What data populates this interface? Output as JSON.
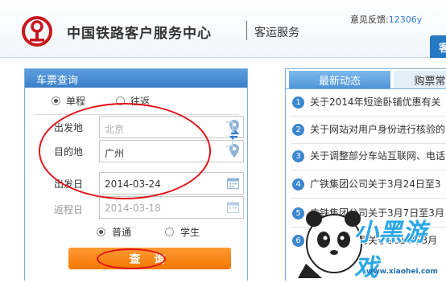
{
  "header": {
    "brand": "中国铁路客户服务中心",
    "subtitle": "客运服务",
    "feedback_label": "意见反馈:",
    "feedback_email": "12306y",
    "top_button": "客"
  },
  "ticket": {
    "title": "车票查询",
    "trip_oneway": "单程",
    "trip_return": "往返",
    "from_label": "出发地",
    "from_value": "北京",
    "to_label": "目的地",
    "to_value": "广州",
    "depart_label": "出发日",
    "depart_value": "2014-03-24",
    "return_label": "返程日",
    "return_value": "2014-03-18",
    "type_normal": "普通",
    "type_student": "学生",
    "search_label": "查 询"
  },
  "news": {
    "tab_active": "最新动态",
    "tab_other": "购票常",
    "items": [
      {
        "num": "1",
        "text": "关于2014年短途卧铺优惠有关"
      },
      {
        "num": "2",
        "text": "关于网站对用户身份进行核验的"
      },
      {
        "num": "3",
        "text": "关于调整部分车站互联网、电话"
      },
      {
        "num": "4",
        "text": "广铁集团公司关于3月24日至3"
      },
      {
        "num": "5",
        "text": "广铁集团公司关于3月7日至3月"
      },
      {
        "num": "6",
        "text": "广铁集团公司关于2014年3月"
      }
    ]
  },
  "watermark": {
    "logo_text": "小黑游戏",
    "url": "www.xiaohei.com"
  },
  "colors": {
    "accent_blue": "#3a7ec8",
    "search_orange": "#f47800",
    "annotation_red": "#e0141a"
  }
}
